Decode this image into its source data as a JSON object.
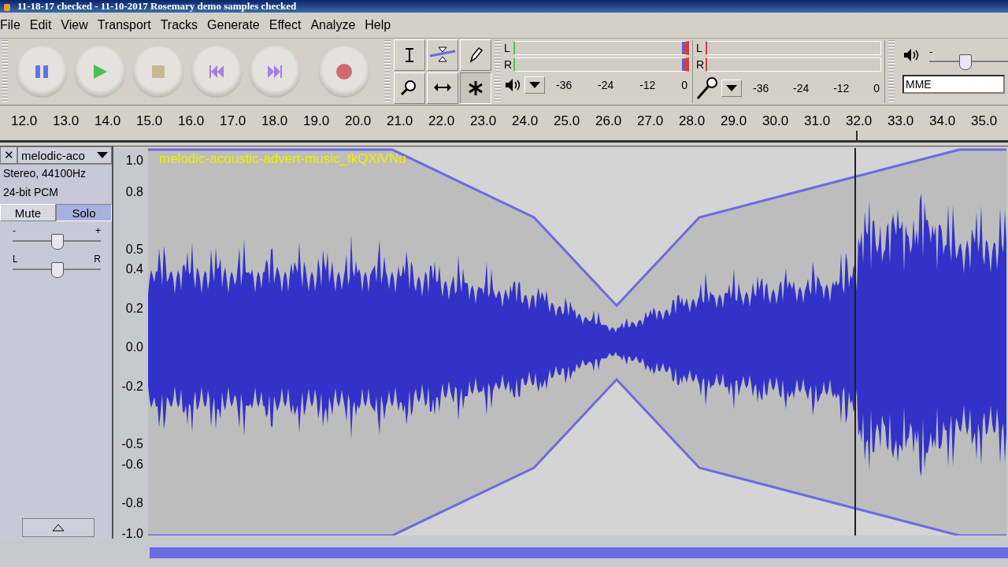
{
  "window": {
    "title": "11-18-17 checked - 11-10-2017 Rosemary demo samples checked"
  },
  "menu": [
    "File",
    "Edit",
    "View",
    "Transport",
    "Tracks",
    "Generate",
    "Effect",
    "Analyze",
    "Help"
  ],
  "transport": [
    {
      "kind": "pause"
    },
    {
      "kind": "play"
    },
    {
      "kind": "stop"
    },
    {
      "kind": "skip-start"
    },
    {
      "kind": "skip-end"
    },
    {
      "kind": "record"
    }
  ],
  "tools": [
    {
      "kind": "select",
      "selected": false
    },
    {
      "kind": "envelope",
      "selected": false
    },
    {
      "kind": "draw",
      "selected": false
    },
    {
      "kind": "zoom",
      "selected": false
    },
    {
      "kind": "timeshift",
      "selected": false
    },
    {
      "kind": "multi",
      "selected": true
    }
  ],
  "meters": [
    {
      "kind": "playback",
      "channels": [
        "L",
        "R"
      ],
      "ticks": [
        "-36",
        "-24",
        "-12",
        "0"
      ]
    },
    {
      "kind": "record",
      "channels": [
        "L",
        "R"
      ],
      "ticks": [
        "-36",
        "-24",
        "-12",
        "0"
      ]
    }
  ],
  "volume": {
    "minus": "-",
    "level": 0.45
  },
  "host": {
    "value": "MME"
  },
  "ruler": [
    "12.0",
    "13.0",
    "14.0",
    "15.0",
    "16.0",
    "17.0",
    "18.0",
    "19.0",
    "20.0",
    "21.0",
    "22.0",
    "23.0",
    "24.0",
    "25.0",
    "26.0",
    "27.0",
    "28.0",
    "29.0",
    "30.0",
    "31.0",
    "32.0",
    "33.0",
    "34.0",
    "35.0"
  ],
  "track": {
    "close": "✕",
    "name": "melodic-aco",
    "info": [
      "Stereo, 44100Hz",
      "24-bit PCM"
    ],
    "buttons": [
      {
        "label": "Mute",
        "selected": false
      },
      {
        "label": "Solo",
        "selected": true
      }
    ],
    "gain": {
      "minus": "-",
      "plus": "+",
      "level": 0.5
    },
    "pan": {
      "left": "L",
      "right": "R",
      "level": 0.5
    },
    "scale": [
      "1.0",
      "0.8",
      "0.5",
      "0.4",
      "0.2",
      "0.0",
      "-0.2",
      "-0.5",
      "-0.6",
      "-0.8",
      "-1.0"
    ],
    "clip": "melodic-acoustic-advert-music_fkQXiVNu"
  }
}
